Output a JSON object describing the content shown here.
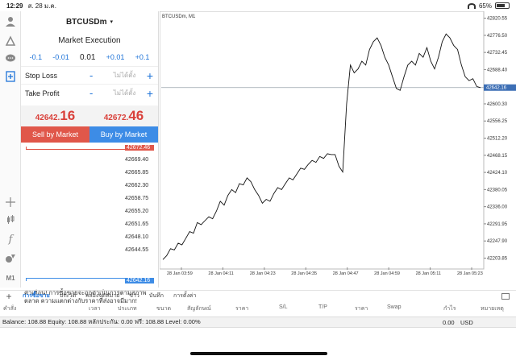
{
  "status": {
    "time": "12:29",
    "date": "ส. 28 ม.ค.",
    "battery": "65%"
  },
  "symbol": {
    "name": "BTCUSDm",
    "caret": "▾"
  },
  "execution": {
    "label": "Market Execution",
    "volume_steps": [
      "-0.1",
      "-0.01",
      "0.01",
      "+0.01",
      "+0.1"
    ],
    "stop_loss": {
      "label": "Stop Loss",
      "minus": "-",
      "placeholder": "ไม่ได้ตั้ง",
      "plus": "+"
    },
    "take_profit": {
      "label": "Take Profit",
      "minus": "-",
      "placeholder": "ไม่ได้ตั้ง",
      "plus": "+"
    },
    "sell_price": {
      "main": "42642.",
      "big": "16"
    },
    "buy_price": {
      "main": "42672.",
      "big": "46"
    },
    "sell_label": "Sell by Market",
    "buy_label": "Buy by Market"
  },
  "depth_prices": [
    "42672.46",
    "42669.40",
    "42665.85",
    "42662.30",
    "42658.75",
    "42655.20",
    "42651.65",
    "42648.10",
    "42644.55",
    "42642.16"
  ],
  "warning": "คำเตือน! การซื้อขายจะถูกดำเนินการตามสภาพตลาด ความแตกต่างกับราคาที่ส่งอาจมีมาก!",
  "left_icons": [
    "user-icon",
    "trade-icon",
    "chat-icon",
    "new-order-icon",
    "crosshair-icon",
    "candles-icon",
    "function-icon",
    "objects-icon",
    "timeframe-label"
  ],
  "timeframe": "M1",
  "tabs": [
    "การซื้อขาย",
    "ประวัติ",
    "กล่องจดหมาย",
    "ข่าว",
    "บันทึก",
    "การตั้งค่า"
  ],
  "columns": [
    "คำสั่ง",
    "เวลา",
    "ประเภท",
    "ขนาด",
    "สัญลักษณ์",
    "ราคา",
    "S/L",
    "T/P",
    "ราคา",
    "Swap",
    "กำไร",
    "หมายเหตุ"
  ],
  "balance_line": "Balance: 108.88 Equity: 108.88 หลักประกัน: 0.00 ฟรี: 108.88 Level: 0.00%",
  "balance_pl": "0.00",
  "balance_currency": "USD",
  "chart_data": {
    "type": "line",
    "title": "BTCUSDm, M1",
    "ylim": [
      42180,
      42830
    ],
    "yticks": [
      42820.55,
      42776.5,
      42732.45,
      42688.4,
      42600.3,
      42556.25,
      42512.2,
      42468.15,
      42424.1,
      42380.05,
      42336.0,
      42291.95,
      42247.9,
      42203.85
    ],
    "current_price": "42642.16",
    "xticks": [
      "28 Jan 03:59",
      "28 Jan 04:11",
      "28 Jan 04:23",
      "28 Jan 04:35",
      "28 Jan 04:47",
      "28 Jan 04:59",
      "28 Jan 05:11",
      "28 Jan 05:23"
    ],
    "values": [
      42200,
      42210,
      42228,
      42225,
      42242,
      42238,
      42255,
      42272,
      42268,
      42295,
      42290,
      42300,
      42310,
      42305,
      42325,
      42350,
      42340,
      42365,
      42380,
      42372,
      42395,
      42392,
      42410,
      42400,
      42380,
      42365,
      42345,
      42355,
      42350,
      42370,
      42385,
      42380,
      42395,
      42410,
      42405,
      42420,
      42435,
      42432,
      42445,
      42455,
      42450,
      42465,
      42460,
      42472,
      42470,
      42470,
      42440,
      42425,
      42600,
      42700,
      42680,
      42690,
      42710,
      42700,
      42740,
      42760,
      42770,
      42750,
      42720,
      42700,
      42670,
      42640,
      42635,
      42670,
      42700,
      42710,
      42700,
      42730,
      42720,
      42745,
      42710,
      42690,
      42720,
      42760,
      42780,
      42770,
      42750,
      42740,
      42700,
      42670,
      42660,
      42665,
      42645,
      42642
    ]
  }
}
